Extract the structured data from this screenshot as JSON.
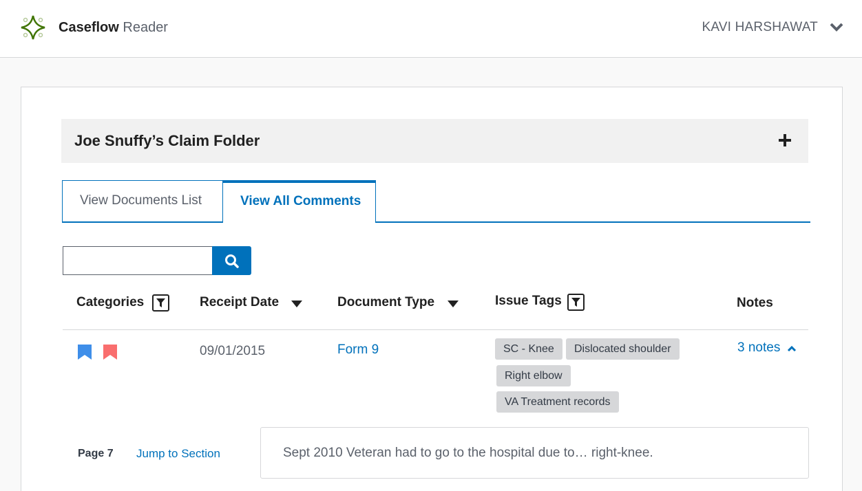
{
  "header": {
    "app_name": "Caseflow",
    "app_sub": "Reader",
    "user_name": "KAVI HARSHAWAT"
  },
  "folder": {
    "title": "Joe Snuffy’s Claim Folder"
  },
  "tabs": [
    {
      "label": "View Documents List",
      "active": false
    },
    {
      "label": "View All Comments",
      "active": true
    }
  ],
  "search": {
    "value": "",
    "placeholder": ""
  },
  "table": {
    "columns": {
      "categories": "Categories",
      "receipt_date": "Receipt Date",
      "document_type": "Document Type",
      "issue_tags": "Issue Tags",
      "notes": "Notes"
    },
    "row": {
      "categories": [
        "blue-bookmark-icon",
        "red-bookmark-icon"
      ],
      "receipt_date": "09/01/2015",
      "document_type": "Form 9",
      "issue_tags": [
        "SC - Knee",
        "Dislocated shoulder",
        "Right elbow",
        "VA Treatment records"
      ],
      "notes": "3 notes"
    }
  },
  "comment": {
    "page": "Page 7",
    "jump_label": "Jump to Section",
    "text": "Sept 2010 Veteran had to go to the hospital due to… right-knee."
  },
  "colors": {
    "accent": "#0071bb",
    "category_blue": "#3e8ee9",
    "category_red": "#f96e6e",
    "logo_green": "#417505",
    "tag_bg": "#d6d7d9"
  }
}
